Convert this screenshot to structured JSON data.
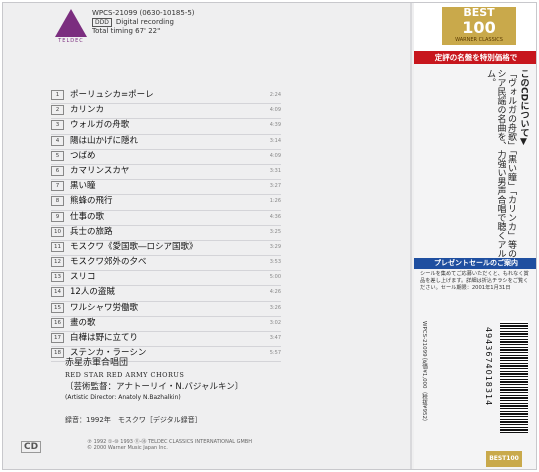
{
  "colors": {
    "accent_red": "#c7161d",
    "accent_blue": "#1f4fa0",
    "gold": "#c9a94b",
    "label_purple": "#7b2e7f"
  },
  "label": {
    "word": "TELDEC"
  },
  "catalog": "WPCS-21099 (0630-10185-5)",
  "digital": "Digital recording",
  "timing": "Total timing 67' 22\"",
  "tracks": [
    {
      "n": "1",
      "title": "ポーリュシカ=ポーレ",
      "dur": "2:24"
    },
    {
      "n": "2",
      "title": "カリンカ",
      "dur": "4:09"
    },
    {
      "n": "3",
      "title": "ウォルガの舟歌",
      "dur": "4:39"
    },
    {
      "n": "4",
      "title": "陽は山かげに隠れ",
      "dur": "3:14"
    },
    {
      "n": "5",
      "title": "つばめ",
      "dur": "4:09"
    },
    {
      "n": "6",
      "title": "カマリンスカヤ",
      "dur": "3:31"
    },
    {
      "n": "7",
      "title": "黒い瞳",
      "dur": "3:27"
    },
    {
      "n": "8",
      "title": "熊蜂の飛行",
      "dur": "1:26"
    },
    {
      "n": "9",
      "title": "仕事の歌",
      "dur": "4:36"
    },
    {
      "n": "10",
      "title": "兵士の旅路",
      "dur": "3:25"
    },
    {
      "n": "11",
      "title": "モスクワ《愛国歌―ロシア国歌》",
      "dur": "3:29"
    },
    {
      "n": "12",
      "title": "モスクワ郊外の夕べ",
      "dur": "3:53"
    },
    {
      "n": "13",
      "title": "スリコ",
      "dur": "5:00"
    },
    {
      "n": "14",
      "title": "12人の盗賊",
      "dur": "4:26"
    },
    {
      "n": "15",
      "title": "ワルシャワ労働歌",
      "dur": "3:26"
    },
    {
      "n": "16",
      "title": "畫の歌",
      "dur": "3:02"
    },
    {
      "n": "17",
      "title": "白樺は野に立てり",
      "dur": "3:47"
    },
    {
      "n": "18",
      "title": "ステンカ・ラーシン",
      "dur": "5:57"
    }
  ],
  "artist": {
    "jp": "赤星赤軍合唱団",
    "en": "RED STAR RED ARMY CHORUS",
    "director_jp": "〔芸術監督：アナトーリイ・N.バジャルキン〕",
    "director_en": "(Artistic Director: Anatoly N.Bazhalkin)"
  },
  "recording": "録音：1992年　モスクワ［デジタル録音］",
  "copyright": {
    "line1": "℗ 1992 ①-⑩ 1993 ⑪-⑱ TELDEC CLASSICS INTERNATIONAL GMBH",
    "line2": "© 2000 Warner Music Japan Inc."
  },
  "cd_logo": "CD",
  "obi": {
    "best": "BEST",
    "hundred": "100",
    "series": "WARNER CLASSICS",
    "banner": "定評の名盤を特別価格で",
    "heading": "このCDについて▼",
    "body": "「ヴォルガの舟歌」「黒い瞳」「カリンカ」等のロシア民謡の名曲を、力強い男声合唱で聴くアルバム。",
    "promo_title": "プレゼントセールのご案内",
    "promo_body": "シールを集めてご応募いただくと、もれなく賞品を差し上げます。詳細は折込チラシをご覧ください。セール期限：2001年1月31日",
    "side_text": "WPCS-21099 定価¥1,000（税抜¥952）",
    "barcode_num": "4943674018314",
    "foot_logo": "BEST100"
  }
}
